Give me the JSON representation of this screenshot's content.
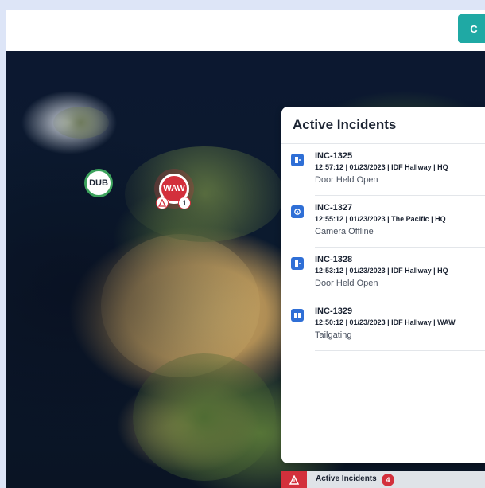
{
  "topbar": {
    "action_button_label": "C"
  },
  "map": {
    "markers": [
      {
        "code": "DUB",
        "status_color": "#3da35d"
      },
      {
        "code": "WAW",
        "status_color": "#d3303c",
        "alert_icon": "warning-triangle-icon",
        "alert_count": "1"
      }
    ]
  },
  "incidents_panel": {
    "title": "Active Incidents",
    "items": [
      {
        "id": "INC-1325",
        "meta": "12:57:12 | 01/23/2023 | IDF Hallway | HQ",
        "type": "Door Held Open",
        "icon": "door-icon"
      },
      {
        "id": "INC-1327",
        "meta": "12:55:12 | 01/23/2023 | The Pacific | HQ",
        "type": "Camera Offline",
        "icon": "camera-icon"
      },
      {
        "id": "INC-1328",
        "meta": "12:53:12 | 01/23/2023 | IDF Hallway | HQ",
        "type": "Door Held Open",
        "icon": "door-icon"
      },
      {
        "id": "INC-1329",
        "meta": "12:50:12 | 01/23/2023 | IDF Hallway | WAW",
        "type": "Tailgating",
        "icon": "tailgating-icon"
      }
    ]
  },
  "bottom_bar": {
    "label": "Active Incidents",
    "count": "4",
    "icon": "warning-triangle-icon"
  },
  "colors": {
    "accent_teal": "#1fa9a4",
    "alert_red": "#d3303c",
    "ok_green": "#3da35d",
    "icon_blue": "#2f6fd6"
  }
}
